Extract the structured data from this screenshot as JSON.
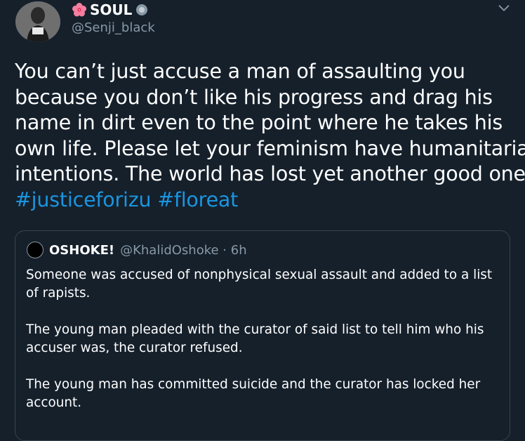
{
  "tweet": {
    "author_name": "SOUL",
    "author_handle": "@Senji_black",
    "text_lines": [
      "You can’t just accuse a man of assaulting you",
      "because you don’t like his progress and drag his",
      "name in dirt even to the point where he takes his",
      "own life. Please let your feminism have humanitarian",
      "intentions. The world has lost yet another good one."
    ],
    "hashtags": [
      "#justiceforizu",
      "#floreat"
    ],
    "icons": {
      "name_prefix": "hibiscus-flower-icon",
      "name_suffix": "protected-badge-icon",
      "menu": "chevron-down-icon"
    }
  },
  "quoted_tweet": {
    "author_name": "OSHOKE!",
    "author_handle_time": "@KhalidOshoke · 6h",
    "paragraphs": [
      "Someone was accused of nonphysical sexual assault and added to a list of rapists.",
      "The young man pleaded with the curator of said list to tell him who his accuser was, the curator refused.",
      "The young man has committed suicide and the curator has locked her account."
    ]
  },
  "colors": {
    "background": "#15202b",
    "text": "#ffffff",
    "secondary_text": "#8899a6",
    "link": "#1b95e0",
    "border": "#38444d"
  }
}
